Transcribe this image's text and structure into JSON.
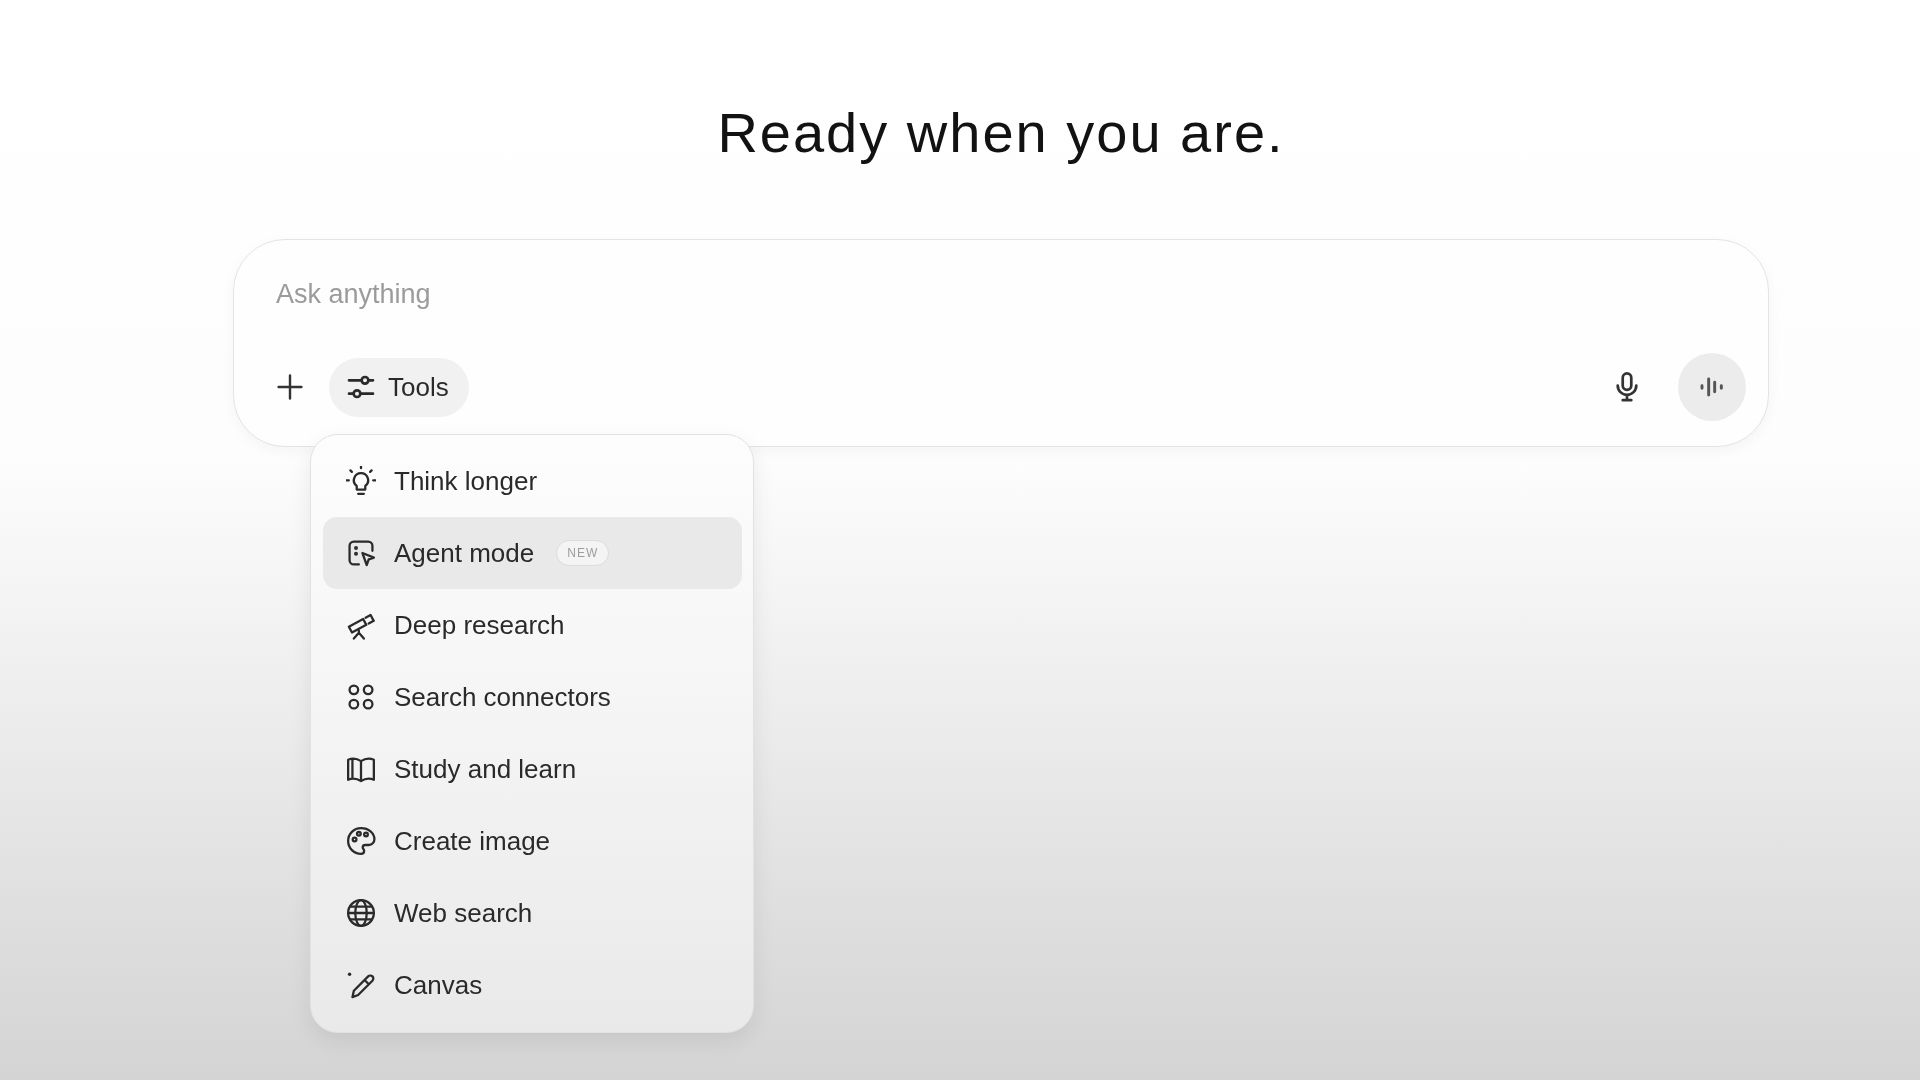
{
  "heading": "Ready when you are.",
  "composer": {
    "placeholder": "Ask anything",
    "tools_button": {
      "label": "Tools",
      "expanded": true
    }
  },
  "tools_menu": {
    "items": [
      {
        "label": "Think longer",
        "selected": false
      },
      {
        "label": "Agent mode",
        "selected": true,
        "badge": "NEW"
      },
      {
        "label": "Deep research",
        "selected": false
      },
      {
        "label": "Search connectors",
        "selected": false
      },
      {
        "label": "Study and learn",
        "selected": false
      },
      {
        "label": "Create image",
        "selected": false
      },
      {
        "label": "Web search",
        "selected": false
      },
      {
        "label": "Canvas",
        "selected": false
      }
    ]
  }
}
